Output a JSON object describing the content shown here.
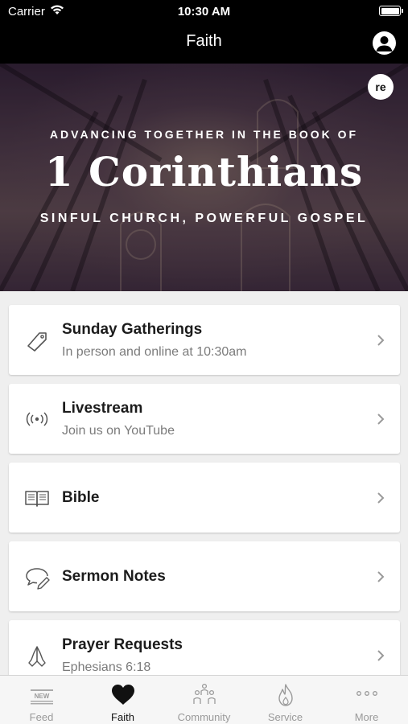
{
  "status_bar": {
    "carrier": "Carrier",
    "time": "10:30 AM"
  },
  "nav": {
    "title": "Faith"
  },
  "hero": {
    "line1": "ADVANCING TOGETHER IN THE BOOK OF",
    "line2": "1 Corinthians",
    "line3": "SINFUL CHURCH, POWERFUL GOSPEL",
    "logo_text": "re"
  },
  "items": [
    {
      "title": "Sunday Gatherings",
      "subtitle": "In person and online at 10:30am",
      "icon": "tag-icon"
    },
    {
      "title": "Livestream",
      "subtitle": "Join us on YouTube",
      "icon": "broadcast-icon"
    },
    {
      "title": "Bible",
      "subtitle": "",
      "icon": "book-icon"
    },
    {
      "title": "Sermon Notes",
      "subtitle": "",
      "icon": "speech-bubble-pencil-icon"
    },
    {
      "title": "Prayer Requests",
      "subtitle": "Ephesians 6:18",
      "icon": "praying-hands-icon"
    }
  ],
  "tabs": [
    {
      "label": "Feed",
      "icon": "news-icon",
      "active": false,
      "badge": "NEW"
    },
    {
      "label": "Faith",
      "icon": "heart-icon",
      "active": true
    },
    {
      "label": "Community",
      "icon": "people-icon",
      "active": false
    },
    {
      "label": "Service",
      "icon": "flame-icon",
      "active": false
    },
    {
      "label": "More",
      "icon": "ellipsis-icon",
      "active": false
    }
  ],
  "colors": {
    "bar": "#000000",
    "background": "#efefef",
    "card": "#ffffff",
    "title_text": "#1c1c1c",
    "subtitle_text": "#7b7b7b",
    "tab_inactive": "#9a9a9a",
    "tab_active": "#111111"
  }
}
